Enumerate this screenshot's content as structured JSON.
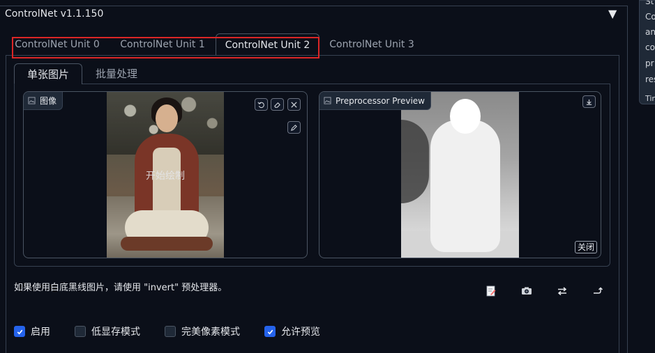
{
  "panel": {
    "title": "ControlNet v1.1.150",
    "collapse_icon": "triangle-down-icon"
  },
  "unit_tabs": [
    {
      "label": "ControlNet Unit 0",
      "active": false
    },
    {
      "label": "ControlNet Unit 1",
      "active": false
    },
    {
      "label": "ControlNet Unit 2",
      "active": true
    },
    {
      "label": "ControlNet Unit 3",
      "active": false
    }
  ],
  "sub_tabs": [
    {
      "label": "单张图片",
      "active": true
    },
    {
      "label": "批量处理",
      "active": false
    }
  ],
  "input_image": {
    "label": "图像",
    "overlay_text": "开始绘制",
    "buttons": [
      "undo-icon",
      "eraser-icon",
      "close-icon",
      "pen-icon"
    ]
  },
  "preview_image": {
    "label": "Preprocessor Preview",
    "download_icon": "download-icon",
    "close_label": "关闭"
  },
  "hint_text": "如果使用白底黑线图片，请使用 \"invert\" 预处理器。",
  "toolbar": [
    "new-canvas-icon",
    "camera-icon",
    "swap-icon",
    "send-dimensions-icon"
  ],
  "options": [
    {
      "label": "启用",
      "checked": true
    },
    {
      "label": "低显存模式",
      "checked": false
    },
    {
      "label": "完美像素模式",
      "checked": false
    },
    {
      "label": "允许预览",
      "checked": true
    }
  ],
  "side_panel": {
    "lines": [
      "St",
      "Co",
      "an",
      "co",
      "pr",
      "res",
      "Tin"
    ]
  },
  "colors": {
    "background": "#0b0f19",
    "accent": "#2563eb",
    "highlight_box": "#dc2626"
  }
}
